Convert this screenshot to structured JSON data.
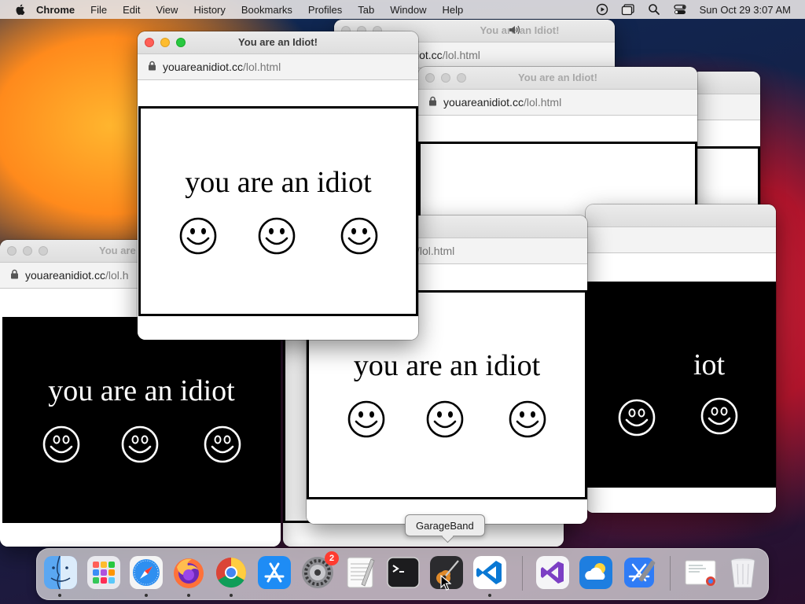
{
  "menubar": {
    "app_name": "Chrome",
    "menus": [
      "File",
      "Edit",
      "View",
      "History",
      "Bookmarks",
      "Profiles",
      "Tab",
      "Window",
      "Help"
    ],
    "clock": "Sun Oct 29  3:07 AM",
    "status_icons": [
      "screen-record-icon",
      "window-icon",
      "search-icon",
      "control-center-icon"
    ]
  },
  "windows": {
    "title": "You are an Idiot!",
    "title_partial_1": "You are",
    "title_partial_2": "u are an Idiot!",
    "url_domain": "youareanidiot.cc",
    "url_path": "/lol.html",
    "url_partial_1": "iot.cc",
    "url_partial_2": "youareanidiot.cc",
    "url_partial_2_path": "/lol.h",
    "message": "you are an idiot",
    "message_partial": "idiot",
    "message_partial_2": "iot"
  },
  "dock": {
    "tooltip": "GarageBand",
    "apps": [
      "Finder",
      "Launchpad",
      "Safari",
      "Firefox",
      "Google Chrome",
      "App Store",
      "System Settings",
      "TextEdit",
      "Terminal",
      "GarageBand",
      "Visual Studio Code",
      "Visual Studio",
      "iCloud Weather",
      "Xcode",
      "Preview",
      "Trash"
    ],
    "settings_badge": "2"
  },
  "colors": {
    "traffic_red": "#ff5f57",
    "traffic_yellow": "#febc2e",
    "traffic_green": "#28c840",
    "badge": "#ff3b30"
  }
}
